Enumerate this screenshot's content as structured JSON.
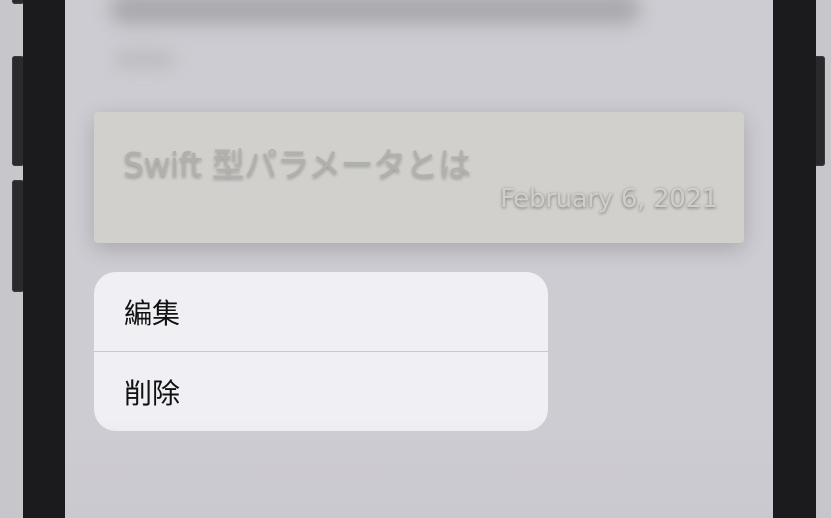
{
  "note_preview": {
    "title": "Swift 型パラメータとは",
    "date": "February 6, 2021"
  },
  "context_menu": {
    "items": [
      {
        "label": "編集"
      },
      {
        "label": "削除"
      }
    ]
  },
  "colors": {
    "screen_background": "#cdccd2",
    "card_background": "#d1d0cd",
    "menu_background": "#f0eff3",
    "menu_text": "#111111",
    "phone_frame": "#1b1b1d"
  }
}
